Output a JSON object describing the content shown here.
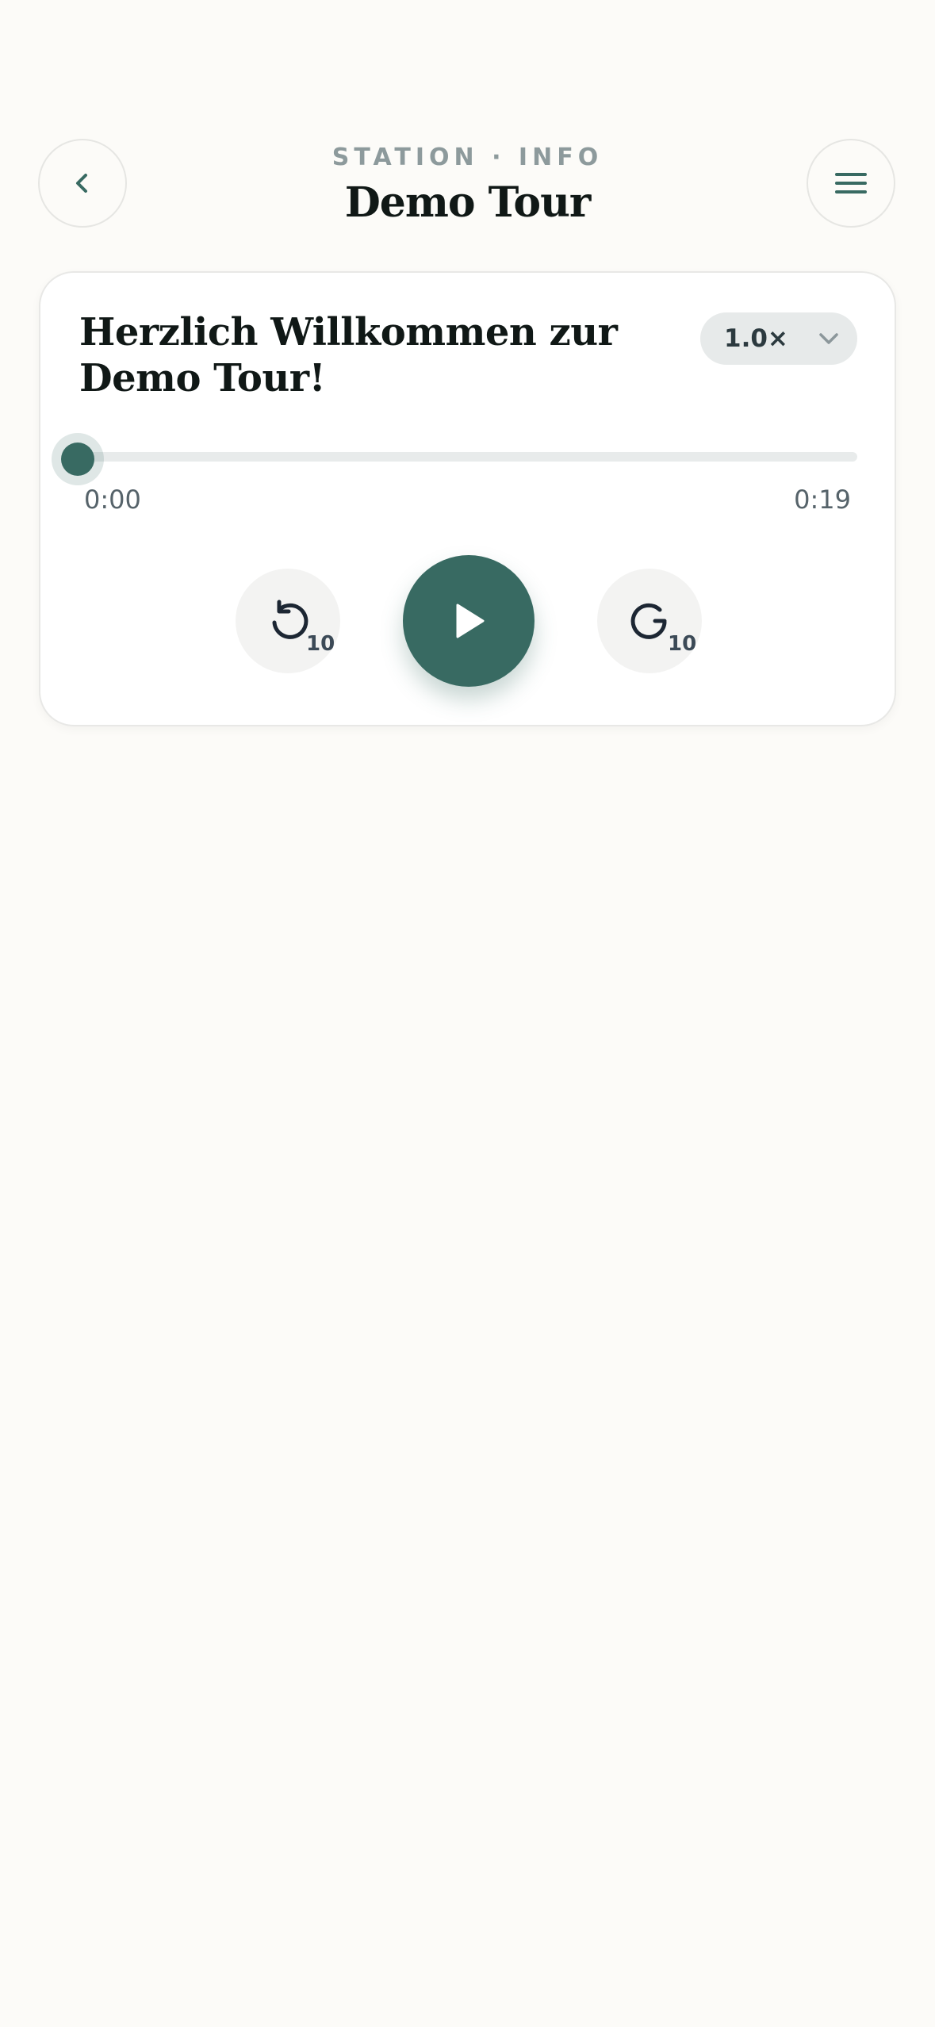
{
  "header": {
    "kicker": "STATION · INFO",
    "title": "Demo Tour",
    "back_icon": "chevron-left-icon",
    "menu_icon": "hamburger-menu-icon"
  },
  "player": {
    "track_title": "Herzlich Willkommen zur Demo Tour!",
    "speed": {
      "value": "1.0×",
      "icon": "chevron-down-icon"
    },
    "progress": {
      "fraction": 0,
      "current_time": "0:00",
      "total_time": "0:19"
    },
    "controls": {
      "skip_back_seconds": "10",
      "skip_forward_seconds": "10",
      "skip_back_icon": "rotate-ccw-icon",
      "skip_forward_icon": "rotate-cw-icon",
      "play_icon": "play-icon"
    }
  },
  "colors": {
    "background": "#fcfbf8",
    "accent": "#386a62",
    "title_text": "#101816",
    "kicker_text": "#8d9a9c"
  }
}
